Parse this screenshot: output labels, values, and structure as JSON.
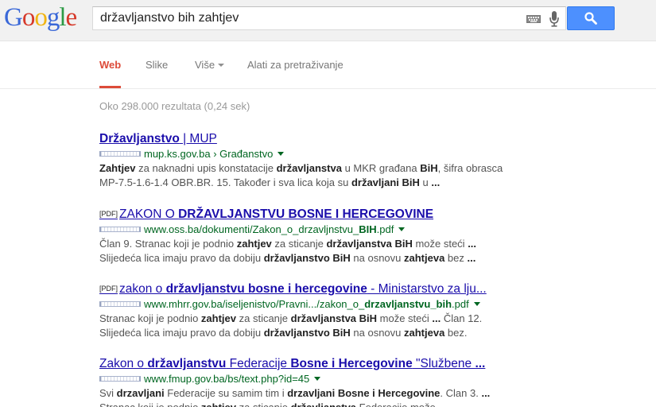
{
  "header": {
    "logo_letters": [
      {
        "ch": "G",
        "color": "#3a68d8"
      },
      {
        "ch": "o",
        "color": "#d6392a"
      },
      {
        "ch": "o",
        "color": "#f1b411"
      },
      {
        "ch": "g",
        "color": "#3a68d8"
      },
      {
        "ch": "l",
        "color": "#2b9a44"
      },
      {
        "ch": "e",
        "color": "#d6392a"
      }
    ],
    "query": "državljanstvo bih zahtjev",
    "keyboard_icon": "keyboard-icon",
    "mic_icon": "microphone-icon",
    "search_icon": "magnifier-icon"
  },
  "tabs": [
    {
      "label": "Web",
      "active": true,
      "dropdown": false
    },
    {
      "label": "Slike",
      "active": false,
      "dropdown": false
    },
    {
      "label": "Više",
      "active": false,
      "dropdown": true
    },
    {
      "label": "Alati za pretraživanje",
      "active": false,
      "dropdown": false
    }
  ],
  "stats": "Oko 298.000 rezultata (0,24 sek)",
  "results": [
    {
      "pdf": "",
      "title": [
        [
          "Državljanstvo",
          true
        ],
        [
          " | MUP",
          false
        ]
      ],
      "url": [
        [
          "mup.ks.gov.ba › Građanstvo",
          false
        ]
      ],
      "snippet1": [
        [
          "Zahtjev",
          true
        ],
        [
          " za naknadni upis konstatacije ",
          false
        ],
        [
          "državljanstva",
          true
        ],
        [
          " u MKR građana ",
          false
        ],
        [
          "BiH",
          true
        ],
        [
          ", šifra obrasca",
          false
        ]
      ],
      "snippet2": [
        [
          "MP-7.5-1.6-1.4 OBR.BR. 15. Također i sva lica koja su ",
          false
        ],
        [
          "državljani BiH",
          true
        ],
        [
          " u ",
          false
        ],
        [
          "...",
          true
        ]
      ]
    },
    {
      "pdf": "[PDF]",
      "title": [
        [
          "ZAKON O ",
          false
        ],
        [
          "DRŽAVLJANSTVU BOSNE I HERCEGOVINE",
          true
        ]
      ],
      "url": [
        [
          "www.oss.ba/dokumenti/Zakon_o_drzavljnstvu_",
          false
        ],
        [
          "BIH",
          true
        ],
        [
          ".pdf",
          false
        ]
      ],
      "snippet1": [
        [
          "Član 9. Stranac koji je podnio ",
          false
        ],
        [
          "zahtjev",
          true
        ],
        [
          " za sticanje ",
          false
        ],
        [
          "državljanstva BiH",
          true
        ],
        [
          " može steći ",
          false
        ],
        [
          "...",
          true
        ]
      ],
      "snippet2": [
        [
          "Slijedeća lica imaju pravo da dobiju ",
          false
        ],
        [
          "državljanstvo BiH",
          true
        ],
        [
          " na osnovu ",
          false
        ],
        [
          "zahtjeva",
          true
        ],
        [
          " bez ",
          false
        ],
        [
          "...",
          true
        ]
      ]
    },
    {
      "pdf": "[PDF]",
      "title": [
        [
          "zakon o ",
          false
        ],
        [
          "državljanstvu bosne i hercegovine",
          true
        ],
        [
          " - Ministarstvo za lju...",
          false
        ]
      ],
      "url": [
        [
          "www.mhrr.gov.ba/iseljenistvo/Pravni.../zakon_o_",
          false
        ],
        [
          "drzavljanstvu_bih",
          true
        ],
        [
          ".pdf",
          false
        ]
      ],
      "snippet1": [
        [
          "Stranac koji je podnio ",
          false
        ],
        [
          "zahtjev",
          true
        ],
        [
          " za sticanje ",
          false
        ],
        [
          "državljanstva BiH",
          true
        ],
        [
          " može steći ",
          false
        ],
        [
          "...",
          true
        ],
        [
          " Član 12.",
          false
        ]
      ],
      "snippet2": [
        [
          "Slijedeća lica imaju pravo da dobiju ",
          false
        ],
        [
          "državljanstvo BiH",
          true
        ],
        [
          " na osnovu ",
          false
        ],
        [
          "zahtjeva",
          true
        ],
        [
          " bez.",
          false
        ]
      ]
    },
    {
      "pdf": "",
      "title": [
        [
          "Zakon o ",
          false
        ],
        [
          "državljanstvu",
          true
        ],
        [
          " Federacije ",
          false
        ],
        [
          "Bosne i Hercegovine",
          true
        ],
        [
          " \"Službene ",
          false
        ],
        [
          "...",
          true
        ]
      ],
      "url": [
        [
          "www.fmup.gov.ba/bs/text.php?id=45",
          false
        ]
      ],
      "snippet1": [
        [
          "Svi ",
          false
        ],
        [
          "drzavljani",
          true
        ],
        [
          " Federacije su samim tim i ",
          false
        ],
        [
          "drzavljani Bosne i Hercegovine",
          true
        ],
        [
          ". Clan 3. ",
          false
        ],
        [
          "...",
          true
        ]
      ],
      "snippet2": [
        [
          "Stranac koji je podnio ",
          false
        ],
        [
          "zahtjev",
          true
        ],
        [
          " za sticanje ",
          false
        ],
        [
          "državljanstva",
          true
        ],
        [
          " Federacije može ",
          false
        ],
        [
          "...",
          true
        ]
      ]
    }
  ]
}
